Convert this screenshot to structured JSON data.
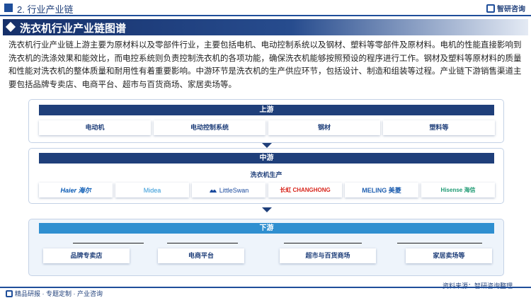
{
  "header": {
    "section_label": "2. 行业产业链",
    "logo_text": "智研咨询"
  },
  "title": "洗衣机行业产业链图谱",
  "intro": "洗衣机行业产业链上游主要为原材料以及零部件行业，主要包括电机、电动控制系统以及钢材、塑料等零部件及原材料。电机的性能直接影响到洗衣机的洗涤效果和能效比，而电控系统则负责控制洗衣机的各项功能，确保洗衣机能够按照预设的程序进行工作。钢材及塑料等原材料的质量和性能对洗衣机的整体质量和耐用性有着重要影响。中游环节是洗衣机的生产供应环节，包括设计、制造和组装等过程。产业链下游销售渠道主要包括品牌专卖店、电商平台、超市与百货商场、家居卖场等。",
  "upstream": {
    "label": "上游",
    "items": [
      "电动机",
      "电动控制系统",
      "钢材",
      "塑料等"
    ]
  },
  "midstream": {
    "label": "中游",
    "subtitle": "洗衣机生产",
    "brands": [
      {
        "name": "Haier 海尔",
        "color": "#0a5bb5"
      },
      {
        "name": "Midea",
        "color": "#2b95d6"
      },
      {
        "name": "LittleSwan",
        "color": "#1a4a9e"
      },
      {
        "name": "长虹 CHANGHONG",
        "color": "#d8261d"
      },
      {
        "name": "MELING 美菱",
        "color": "#1f5fb0"
      },
      {
        "name": "Hisense 海信",
        "color": "#1e9a73"
      }
    ]
  },
  "downstream": {
    "label": "下游",
    "items": [
      "品牌专卖店",
      "电商平台",
      "超市与百货商场",
      "家居卖场等"
    ]
  },
  "footer": {
    "left_text": "精品研报 · 专题定制 · 产业咨询",
    "source": "资料来源：智研咨询整理"
  }
}
